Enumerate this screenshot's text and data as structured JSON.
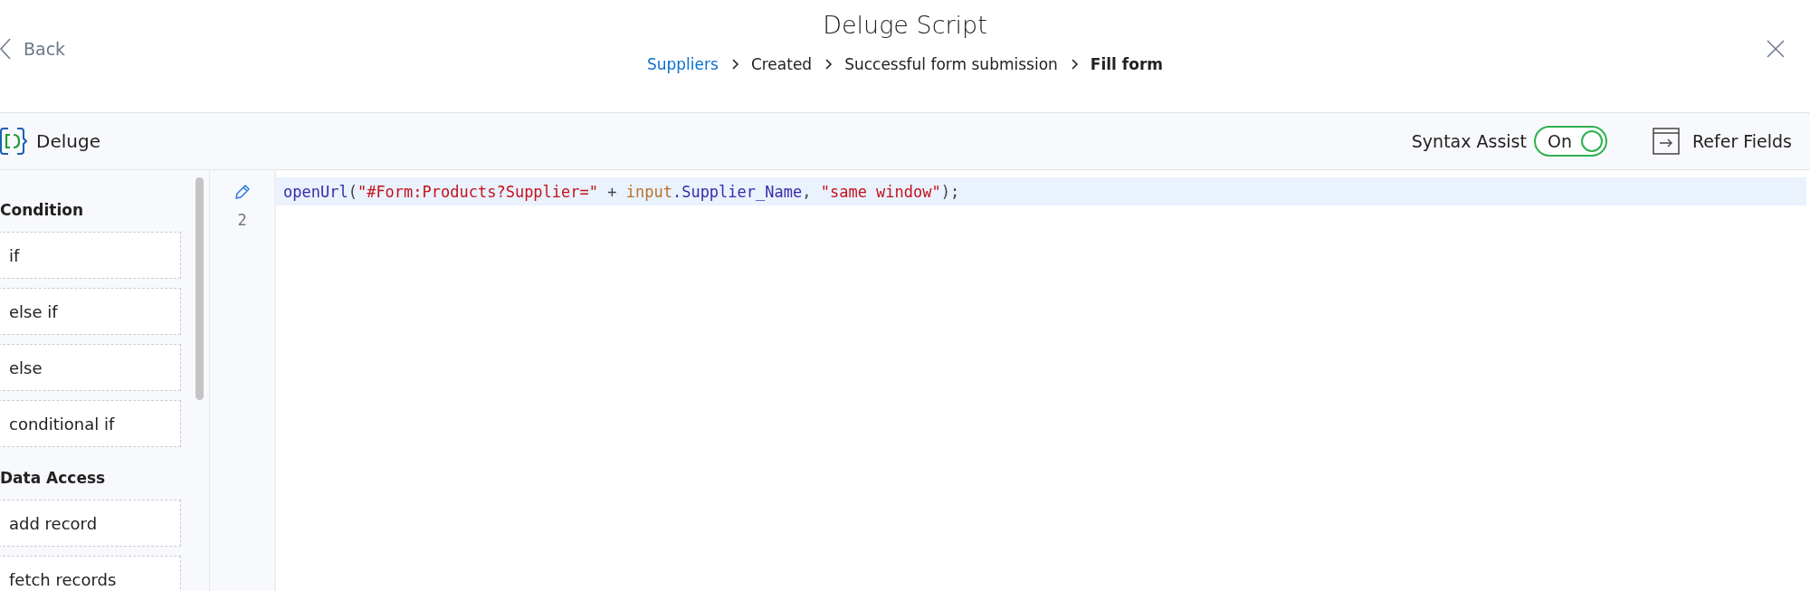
{
  "header": {
    "title": "Deluge Script",
    "back": "Back",
    "breadcrumb": [
      {
        "label": "Suppliers",
        "kind": "link"
      },
      {
        "label": "Created",
        "kind": "text"
      },
      {
        "label": "Successful form submission",
        "kind": "text"
      },
      {
        "label": "Fill form",
        "kind": "current"
      }
    ]
  },
  "toolbar": {
    "logo_label": "Deluge",
    "syntax_assist": {
      "label": "Syntax Assist",
      "toggle_text": "On",
      "on": true
    },
    "refer_fields": "Refer Fields"
  },
  "sidebar": {
    "sections": [
      {
        "heading": "Condition",
        "items": [
          "if",
          "else if",
          "else",
          "conditional if"
        ]
      },
      {
        "heading": "Data Access",
        "items": [
          "add record",
          "fetch records"
        ]
      }
    ]
  },
  "editor": {
    "lines": [
      {
        "editing": true,
        "tokens": [
          {
            "text": "openUrl",
            "kind": "function"
          },
          {
            "text": "(",
            "kind": "punct"
          },
          {
            "text": "\"#Form:Products?Supplier=\"",
            "kind": "string"
          },
          {
            "text": " + ",
            "kind": "punct"
          },
          {
            "text": "input",
            "kind": "keyword"
          },
          {
            "text": ".Supplier_Name",
            "kind": "function"
          },
          {
            "text": ", ",
            "kind": "punct"
          },
          {
            "text": "\"same window\"",
            "kind": "string"
          },
          {
            "text": ");",
            "kind": "punct"
          }
        ]
      },
      {
        "editing": false,
        "number": "2"
      }
    ]
  }
}
